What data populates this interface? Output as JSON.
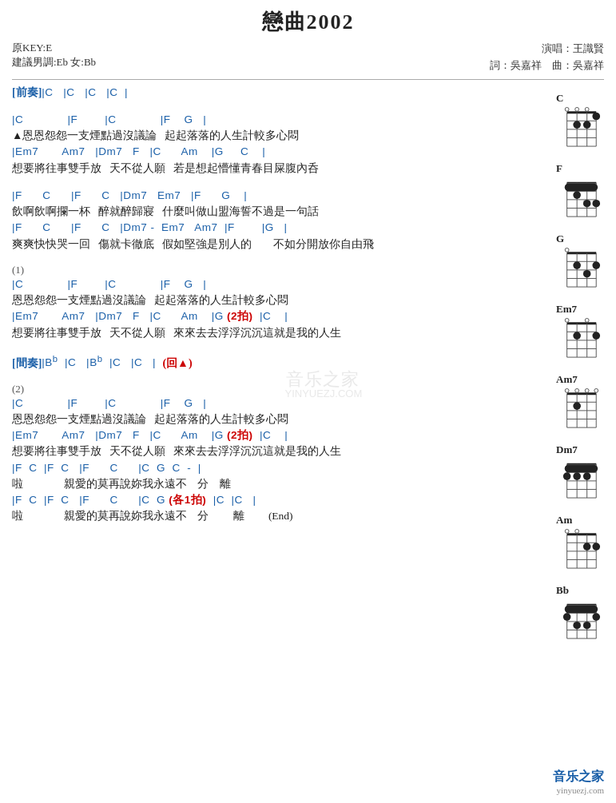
{
  "title": "戀曲2002",
  "meta": {
    "key": "原KEY:E",
    "suggestion": "建議男調:Eb 女:Bb",
    "singer": "演唱：王識賢",
    "lyricist": "詞：吳嘉祥",
    "composer": "曲：吳嘉祥"
  },
  "sections": [
    {
      "id": "prelude",
      "label": "[前奏]",
      "lines": [
        {
          "type": "chord",
          "text": "|C   |C   |C   |C  |"
        }
      ]
    },
    {
      "id": "verse1",
      "lines": [
        {
          "type": "chord",
          "text": "|C             |F        |C             |F    G   |"
        },
        {
          "type": "lyric",
          "text": "▲恩恩怨怨一支煙點過沒議論   起起落落的人生計較多心悶"
        },
        {
          "type": "chord",
          "text": "|Em7       Am7   |Dm7   F   |C      Am    |G     C    |"
        },
        {
          "type": "lyric",
          "text": "想要將往事雙手放   天不從人願   若是想起懵懂青春目屎腹內呑"
        }
      ]
    },
    {
      "id": "verse2",
      "lines": [
        {
          "type": "chord",
          "text": "|F      C      |F      C   |Dm7   Em7   |F      G    |"
        },
        {
          "type": "lyric",
          "text": "飲啊飲啊攔一杯   醉就醉歸寢   什麼叫做山盟海誓不過是一句話"
        },
        {
          "type": "chord",
          "text": "|F      C      |F      C   |Dm7 -  Em7   Am7  |F        |G   |"
        },
        {
          "type": "lyric",
          "text": "爽爽快快哭一回   傷就卡徹底   假如堅強是別人的        不如分開放你自由飛"
        }
      ]
    },
    {
      "id": "chorus1",
      "label": "(1)",
      "lines": [
        {
          "type": "chord",
          "text": "|C             |F        |C             |F    G   |"
        },
        {
          "type": "lyric",
          "text": "恩恩怨怨一支煙點過沒議論   起起落落的人生計較多心悶"
        },
        {
          "type": "chord",
          "text": "|Em7       Am7   |Dm7   F   |C      Am    |G (2拍)  |C    |"
        },
        {
          "type": "lyric",
          "text": "想要將往事雙手放   天不從人願   來來去去浮浮沉沉這就是我的人生"
        }
      ]
    },
    {
      "id": "interlude",
      "label": "[間奏]",
      "lines": [
        {
          "type": "interlude",
          "text": "|B♭  |C   |B♭  |C   |C   |  (回▲)"
        }
      ]
    },
    {
      "id": "chorus2",
      "label": "(2)",
      "lines": [
        {
          "type": "chord",
          "text": "|C             |F        |C             |F    G   |"
        },
        {
          "type": "lyric",
          "text": "恩恩怨怨一支煙點過沒議論   起起落落的人生計較多心悶"
        },
        {
          "type": "chord",
          "text": "|Em7       Am7   |Dm7   F   |C      Am    |G (2拍)  |C    |"
        },
        {
          "type": "lyric",
          "text": "想要將往事雙手放   天不從人願   來來去去浮浮沉沉這就是我的人生"
        },
        {
          "type": "chord",
          "text": "|F  C  |F  C   |F      C      |C  G  C  -  |"
        },
        {
          "type": "lyric",
          "text": "啦               親愛的莫再說妳我永遠不    分    離"
        },
        {
          "type": "chord",
          "text": "|F  C  |F  C   |F      C      |C  G (各1拍)  |C  |C   |"
        },
        {
          "type": "lyric",
          "text": "啦               親愛的莫再說妳我永遠不    分         離         (End)"
        }
      ]
    }
  ],
  "chords": [
    {
      "name": "C",
      "open_strings": [
        0,
        0,
        0
      ],
      "frets": [
        0,
        3,
        2,
        0
      ],
      "fingers": [],
      "muted": [],
      "position": 0
    },
    {
      "name": "F",
      "open_strings": [],
      "frets": [
        1,
        1,
        2,
        3
      ],
      "fingers": [],
      "muted": [],
      "position": 0,
      "barre": true
    },
    {
      "name": "G",
      "open_strings": [
        0
      ],
      "frets": [
        0,
        2,
        3,
        2
      ],
      "fingers": [],
      "muted": [],
      "position": 0
    },
    {
      "name": "Em7",
      "open_strings": [
        0,
        0
      ],
      "frets": [
        0,
        2,
        0,
        2
      ],
      "fingers": [],
      "muted": [],
      "position": 0
    },
    {
      "name": "Am7",
      "open_strings": [
        0,
        0,
        0,
        0
      ],
      "frets": [
        0,
        0,
        2,
        0
      ],
      "fingers": [],
      "muted": [],
      "position": 0
    },
    {
      "name": "Dm7",
      "open_strings": [],
      "frets": [
        2,
        1,
        2,
        1
      ],
      "fingers": [],
      "muted": [],
      "position": 0
    },
    {
      "name": "Am",
      "open_strings": [
        0,
        0
      ],
      "frets": [
        0,
        0,
        2,
        2
      ],
      "fingers": [],
      "muted": [],
      "position": 0
    },
    {
      "name": "Bb",
      "open_strings": [],
      "frets": [
        1,
        1,
        3,
        3
      ],
      "fingers": [],
      "muted": [],
      "position": 0
    }
  ],
  "watermark": {
    "line1": "音乐之家",
    "line2": "YINYUEZJ.COM"
  },
  "bottom_logo": {
    "main": "音乐之家",
    "sub": "yinyuezj.com"
  }
}
